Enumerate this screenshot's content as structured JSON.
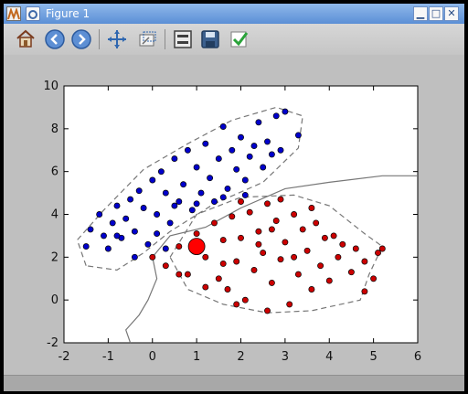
{
  "window": {
    "title": "Figure 1",
    "icons": {
      "app": "matplotlib-icon",
      "menu": "window-menu-icon",
      "minimize": "minimize-icon",
      "maximize": "maximize-icon",
      "close": "close-icon"
    },
    "buttons": {
      "minimize": "▁",
      "maximize": "□",
      "close": "✕"
    }
  },
  "toolbar": {
    "tools": [
      {
        "name": "home-icon"
      },
      {
        "name": "back-arrow-icon"
      },
      {
        "name": "forward-arrow-icon"
      },
      {
        "name": "pan-icon"
      },
      {
        "name": "zoom-icon"
      },
      {
        "name": "subplots-icon"
      },
      {
        "name": "save-icon"
      },
      {
        "name": "checkmark-icon"
      }
    ]
  },
  "chart_data": {
    "type": "scatter",
    "title": "",
    "xlabel": "",
    "ylabel": "",
    "xlim": [
      -2,
      6
    ],
    "ylim": [
      -2,
      10
    ],
    "x_ticks": [
      "-2",
      "-1",
      "0",
      "1",
      "2",
      "3",
      "4",
      "5",
      "6"
    ],
    "y_ticks": [
      "-2",
      "0",
      "2",
      "4",
      "6",
      "8",
      "10"
    ],
    "grid": false,
    "legend": "",
    "series": [
      {
        "color": "#0000cc",
        "points": [
          [
            -1.5,
            2.5
          ],
          [
            -1.4,
            3.3
          ],
          [
            -1.2,
            4.0
          ],
          [
            -1.1,
            3.0
          ],
          [
            -1.0,
            2.4
          ],
          [
            -0.9,
            3.6
          ],
          [
            -0.8,
            4.4
          ],
          [
            -0.7,
            2.9
          ],
          [
            -0.6,
            3.8
          ],
          [
            -0.5,
            4.7
          ],
          [
            -0.4,
            3.2
          ],
          [
            -0.3,
            5.1
          ],
          [
            -0.2,
            4.3
          ],
          [
            -0.1,
            2.6
          ],
          [
            0.0,
            5.6
          ],
          [
            0.1,
            4.0
          ],
          [
            0.2,
            6.0
          ],
          [
            0.3,
            5.0
          ],
          [
            0.4,
            3.6
          ],
          [
            0.5,
            6.6
          ],
          [
            0.6,
            4.6
          ],
          [
            0.7,
            5.4
          ],
          [
            0.8,
            7.0
          ],
          [
            0.9,
            4.2
          ],
          [
            1.0,
            6.2
          ],
          [
            1.1,
            5.0
          ],
          [
            1.2,
            7.3
          ],
          [
            1.3,
            5.7
          ],
          [
            1.4,
            4.6
          ],
          [
            1.5,
            6.6
          ],
          [
            1.6,
            8.1
          ],
          [
            1.7,
            5.2
          ],
          [
            1.8,
            7.0
          ],
          [
            1.9,
            6.1
          ],
          [
            2.0,
            7.6
          ],
          [
            2.1,
            5.6
          ],
          [
            2.2,
            6.7
          ],
          [
            2.3,
            7.2
          ],
          [
            2.4,
            8.3
          ],
          [
            2.5,
            6.2
          ],
          [
            2.6,
            7.4
          ],
          [
            2.7,
            6.8
          ],
          [
            2.8,
            8.6
          ],
          [
            2.9,
            7.0
          ],
          [
            3.0,
            8.8
          ],
          [
            3.3,
            7.7
          ],
          [
            0.1,
            3.1
          ],
          [
            -0.8,
            3.0
          ],
          [
            0.5,
            4.4
          ],
          [
            1.0,
            4.5
          ],
          [
            1.6,
            4.8
          ],
          [
            2.1,
            4.9
          ],
          [
            -0.4,
            2.0
          ],
          [
            0.3,
            2.4
          ]
        ]
      },
      {
        "color": "#cc0000",
        "points": [
          [
            0.0,
            2.0
          ],
          [
            0.3,
            1.6
          ],
          [
            0.6,
            2.5
          ],
          [
            0.8,
            1.2
          ],
          [
            1.0,
            3.1
          ],
          [
            1.2,
            2.0
          ],
          [
            1.4,
            3.6
          ],
          [
            1.5,
            1.0
          ],
          [
            1.6,
            2.8
          ],
          [
            1.7,
            0.5
          ],
          [
            1.8,
            3.9
          ],
          [
            1.9,
            1.8
          ],
          [
            2.0,
            2.9
          ],
          [
            2.1,
            0.0
          ],
          [
            2.2,
            4.1
          ],
          [
            2.3,
            1.4
          ],
          [
            2.4,
            3.2
          ],
          [
            2.5,
            2.2
          ],
          [
            2.6,
            4.5
          ],
          [
            2.7,
            0.8
          ],
          [
            2.8,
            3.7
          ],
          [
            2.9,
            1.9
          ],
          [
            3.0,
            2.7
          ],
          [
            3.1,
            -0.2
          ],
          [
            3.2,
            4.0
          ],
          [
            3.3,
            1.2
          ],
          [
            3.4,
            3.3
          ],
          [
            3.5,
            2.3
          ],
          [
            3.6,
            0.5
          ],
          [
            3.7,
            3.6
          ],
          [
            3.8,
            1.6
          ],
          [
            3.9,
            2.9
          ],
          [
            4.0,
            0.9
          ],
          [
            4.1,
            3.0
          ],
          [
            4.2,
            2.0
          ],
          [
            4.3,
            2.6
          ],
          [
            4.5,
            1.3
          ],
          [
            4.6,
            2.4
          ],
          [
            4.8,
            1.8
          ],
          [
            5.0,
            1.0
          ],
          [
            5.1,
            2.2
          ],
          [
            5.2,
            2.4
          ],
          [
            4.8,
            0.4
          ],
          [
            2.6,
            -0.5
          ],
          [
            1.9,
            -0.2
          ],
          [
            1.2,
            0.6
          ],
          [
            0.6,
            1.2
          ],
          [
            2.0,
            4.6
          ],
          [
            2.9,
            4.7
          ],
          [
            3.6,
            4.3
          ],
          [
            2.4,
            2.6
          ],
          [
            2.7,
            3.3
          ],
          [
            3.2,
            2.0
          ],
          [
            1.6,
            1.7
          ]
        ]
      }
    ],
    "highlight": {
      "x": 1.0,
      "y": 2.5,
      "color": "#ff0000"
    },
    "contours": {
      "color": "#777777",
      "blue_region": [
        [
          -1.5,
          1.6
        ],
        [
          -1.7,
          2.8
        ],
        [
          -1.1,
          4.2
        ],
        [
          -0.2,
          6.1
        ],
        [
          0.8,
          7.3
        ],
        [
          1.8,
          8.4
        ],
        [
          2.8,
          9.0
        ],
        [
          3.4,
          8.6
        ],
        [
          3.3,
          7.1
        ],
        [
          2.5,
          5.5
        ],
        [
          1.4,
          4.5
        ],
        [
          0.4,
          3.2
        ],
        [
          -0.2,
          2.2
        ],
        [
          -0.8,
          1.4
        ]
      ],
      "red_region": [
        [
          0.4,
          2.0
        ],
        [
          1.0,
          4.0
        ],
        [
          2.0,
          4.8
        ],
        [
          3.2,
          4.9
        ],
        [
          4.0,
          4.4
        ],
        [
          4.8,
          3.1
        ],
        [
          5.2,
          2.5
        ],
        [
          4.9,
          1.2
        ],
        [
          4.7,
          0.0
        ],
        [
          3.6,
          -0.5
        ],
        [
          2.6,
          -0.6
        ],
        [
          1.6,
          -0.2
        ],
        [
          0.8,
          0.5
        ]
      ],
      "boundary": [
        [
          -0.5,
          -2.0
        ],
        [
          -0.6,
          -1.4
        ],
        [
          -0.3,
          -0.7
        ],
        [
          -0.1,
          0.0
        ],
        [
          0.1,
          1.0
        ],
        [
          0.0,
          2.0
        ],
        [
          0.4,
          3.0
        ],
        [
          1.2,
          3.4
        ],
        [
          2.0,
          4.3
        ],
        [
          3.0,
          5.2
        ],
        [
          4.0,
          5.5
        ],
        [
          5.2,
          5.8
        ],
        [
          6.0,
          5.8
        ]
      ]
    }
  }
}
